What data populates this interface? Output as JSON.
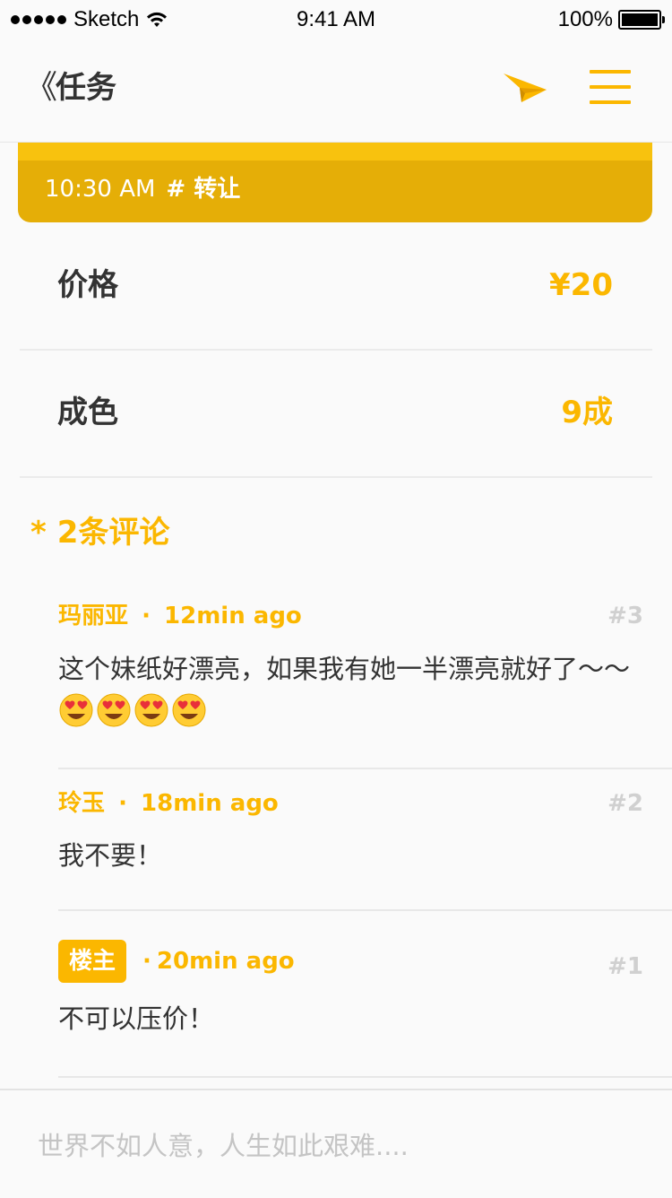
{
  "status_bar": {
    "carrier": "Sketch",
    "time": "9:41 AM",
    "battery": "100%"
  },
  "nav": {
    "back_glyph": "《",
    "title": "任务",
    "icons": [
      "send-icon",
      "menu-icon"
    ],
    "accent_color": "#fbb700"
  },
  "header_card": {
    "time": "10:30 AM",
    "tag": "# 转让"
  },
  "info_rows": [
    {
      "label": "价格",
      "value": "¥20"
    },
    {
      "label": "成色",
      "value": "9成"
    }
  ],
  "comments_section": {
    "star": "*",
    "title": "2条评论"
  },
  "comments": [
    {
      "author": "玛丽亚",
      "separator": "·",
      "time": "12min ago",
      "number": "#3",
      "text": "这个妹纸好漂亮，如果我有她一半漂亮就好了～～",
      "emoji": [
        "heart-eyes-emoji",
        "heart-eyes-emoji",
        "heart-eyes-emoji",
        "heart-eyes-emoji"
      ]
    },
    {
      "author": "玲玉",
      "separator": "·",
      "time": "18min ago",
      "number": "#2",
      "text": "我不要！"
    },
    {
      "author": "楼主",
      "is_owner": true,
      "separator": "·",
      "time": "20min ago",
      "number": "#1",
      "text": "不可以压价！"
    }
  ],
  "composer": {
    "placeholder": "世界不如人意，人生如此艰难...."
  }
}
